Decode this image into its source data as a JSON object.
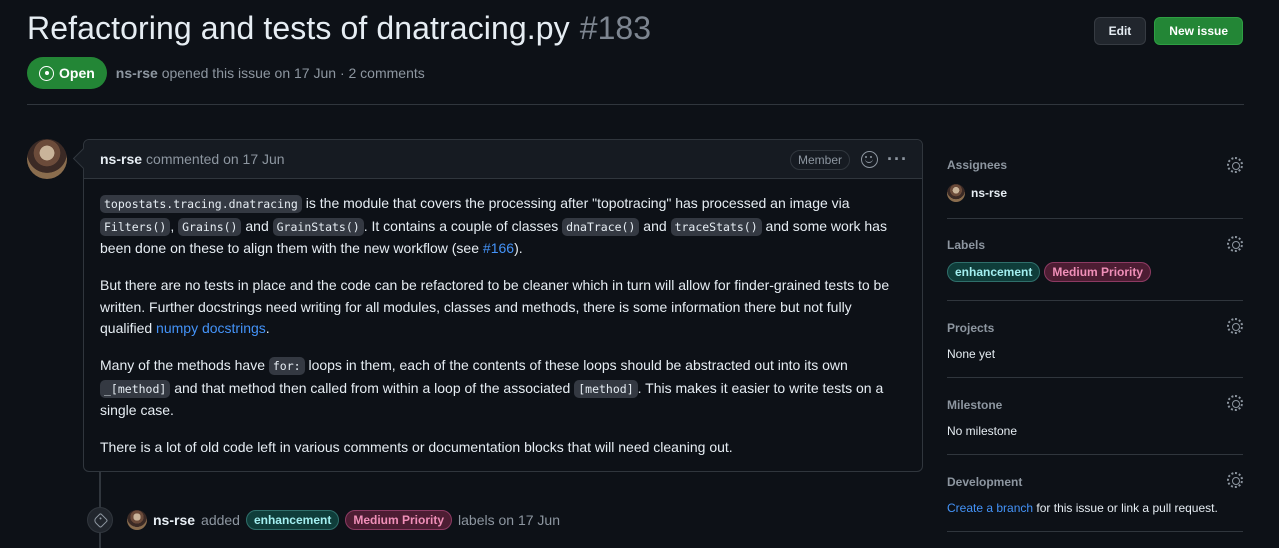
{
  "issue": {
    "title": "Refactoring and tests of dnatracing.py",
    "number": "#183",
    "state": "Open",
    "author": "ns-rse",
    "opened_text": "opened this issue on 17 Jun · 2 comments"
  },
  "header": {
    "edit_label": "Edit",
    "new_issue_label": "New issue"
  },
  "comment": {
    "author": "ns-rse",
    "time": "commented on 17 Jun",
    "badge": "Member",
    "more_icon": "kebab-horizontal-icon",
    "reaction_icon": "smiley-icon",
    "p1": {
      "code1": "topostats.tracing.dnatracing",
      "t1": " is the module that covers the processing after \"topotracing\" has processed an image via ",
      "code2": "Filters()",
      "t2": ", ",
      "code3": "Grains()",
      "t3": " and ",
      "code4": "GrainStats()",
      "t4": ". It contains a couple of classes ",
      "code5": "dnaTrace()",
      "t5": " and ",
      "code6": "traceStats()",
      "t6": " and some work has been done on these to align them with the new workflow (see ",
      "link": "#166",
      "t7": ")."
    },
    "p2": {
      "t1": "But there are no tests in place and the code can be refactored to be cleaner which in turn will allow for finder-grained tests to be written. Further docstrings need writing for all modules, classes and methods, there is some information there but not fully qualified ",
      "link": "numpy docstrings",
      "t2": "."
    },
    "p3": {
      "t1": "Many of the methods have ",
      "code1": "for:",
      "t2": " loops in them, each of the contents of these loops should be abstracted out into its own ",
      "code2": "_[method]",
      "t3": " and that method then called from within a loop of the associated ",
      "code3": "[method]",
      "t4": ". This makes it easier to write tests on a single case."
    },
    "p4": "There is a lot of old code left in various comments or documentation blocks that will need cleaning out."
  },
  "event": {
    "icon": "tag-icon",
    "actor": "ns-rse",
    "action": "added",
    "labels": [
      "enhancement",
      "Medium Priority"
    ],
    "suffix": "labels on 17 Jun"
  },
  "sidebar": {
    "assignees": {
      "title": "Assignees",
      "value": "ns-rse"
    },
    "labels": {
      "title": "Labels",
      "items": [
        "enhancement",
        "Medium Priority"
      ]
    },
    "projects": {
      "title": "Projects",
      "value": "None yet"
    },
    "milestone": {
      "title": "Milestone",
      "value": "No milestone"
    },
    "development": {
      "title": "Development",
      "link": "Create a branch",
      "text": " for this issue or link a pull request."
    }
  },
  "colors": {
    "open_green": "#238636",
    "link_blue": "#4493f8",
    "bg": "#0d1117"
  }
}
